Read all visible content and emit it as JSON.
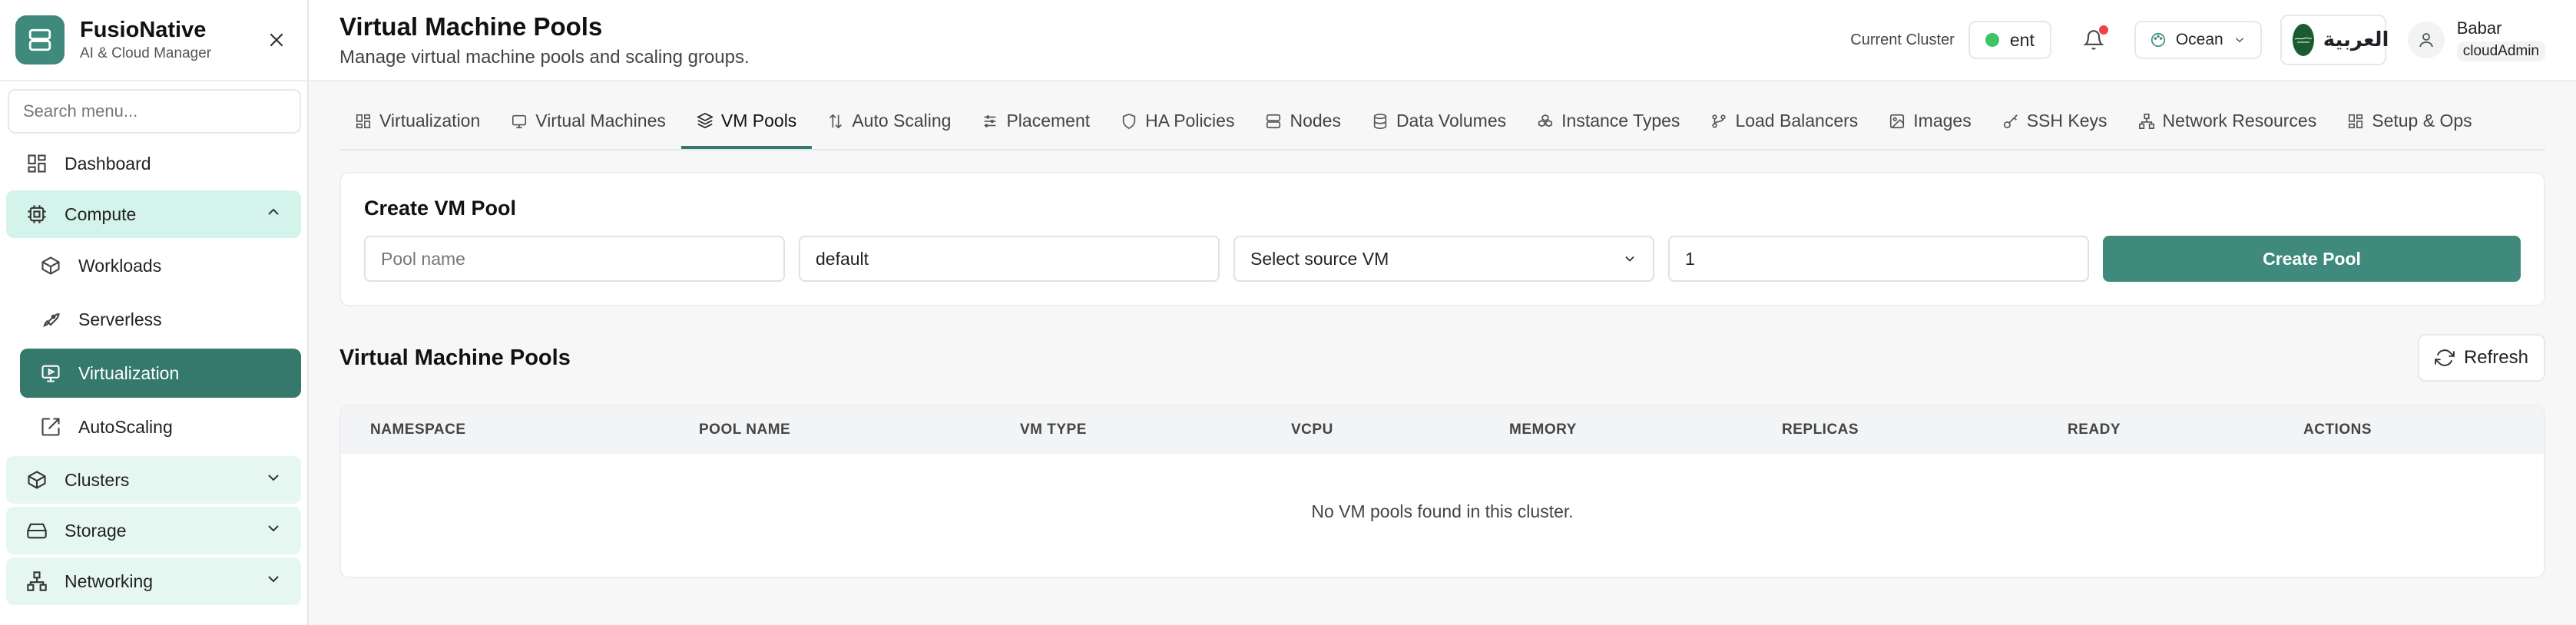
{
  "brand": {
    "title": "FusioNative",
    "subtitle": "AI & Cloud Manager"
  },
  "sidebar": {
    "search_placeholder": "Search menu...",
    "dashboard": "Dashboard",
    "compute": "Compute",
    "compute_items": [
      "Workloads",
      "Serverless",
      "Virtualization",
      "AutoScaling"
    ],
    "clusters": "Clusters",
    "storage": "Storage",
    "networking": "Networking"
  },
  "header": {
    "title": "Virtual Machine Pools",
    "subtitle": "Manage virtual machine pools and scaling groups.",
    "cluster_label": "Current Cluster",
    "cluster_value": "ent",
    "theme": "Ocean",
    "language": "العربية",
    "user_name": "Babar",
    "user_role": "cloudAdmin"
  },
  "tabs": [
    "Virtualization",
    "Virtual Machines",
    "VM Pools",
    "Auto Scaling",
    "Placement",
    "HA Policies",
    "Nodes",
    "Data Volumes",
    "Instance Types",
    "Load Balancers",
    "Images",
    "SSH Keys",
    "Network Resources",
    "Setup & Ops"
  ],
  "create": {
    "title": "Create VM Pool",
    "pool_name_placeholder": "Pool name",
    "namespace_value": "default",
    "source_vm": "Select source VM",
    "replicas_value": "1",
    "button": "Create Pool"
  },
  "pools": {
    "title": "Virtual Machine Pools",
    "refresh": "Refresh",
    "columns": [
      "NAMESPACE",
      "POOL NAME",
      "VM TYPE",
      "VCPU",
      "MEMORY",
      "REPLICAS",
      "READY",
      "ACTIONS"
    ],
    "empty": "No VM pools found in this cluster."
  },
  "colors": {
    "accent": "#3f8a7c",
    "active": "#35786c",
    "group_bg": "#e6f7f2"
  }
}
